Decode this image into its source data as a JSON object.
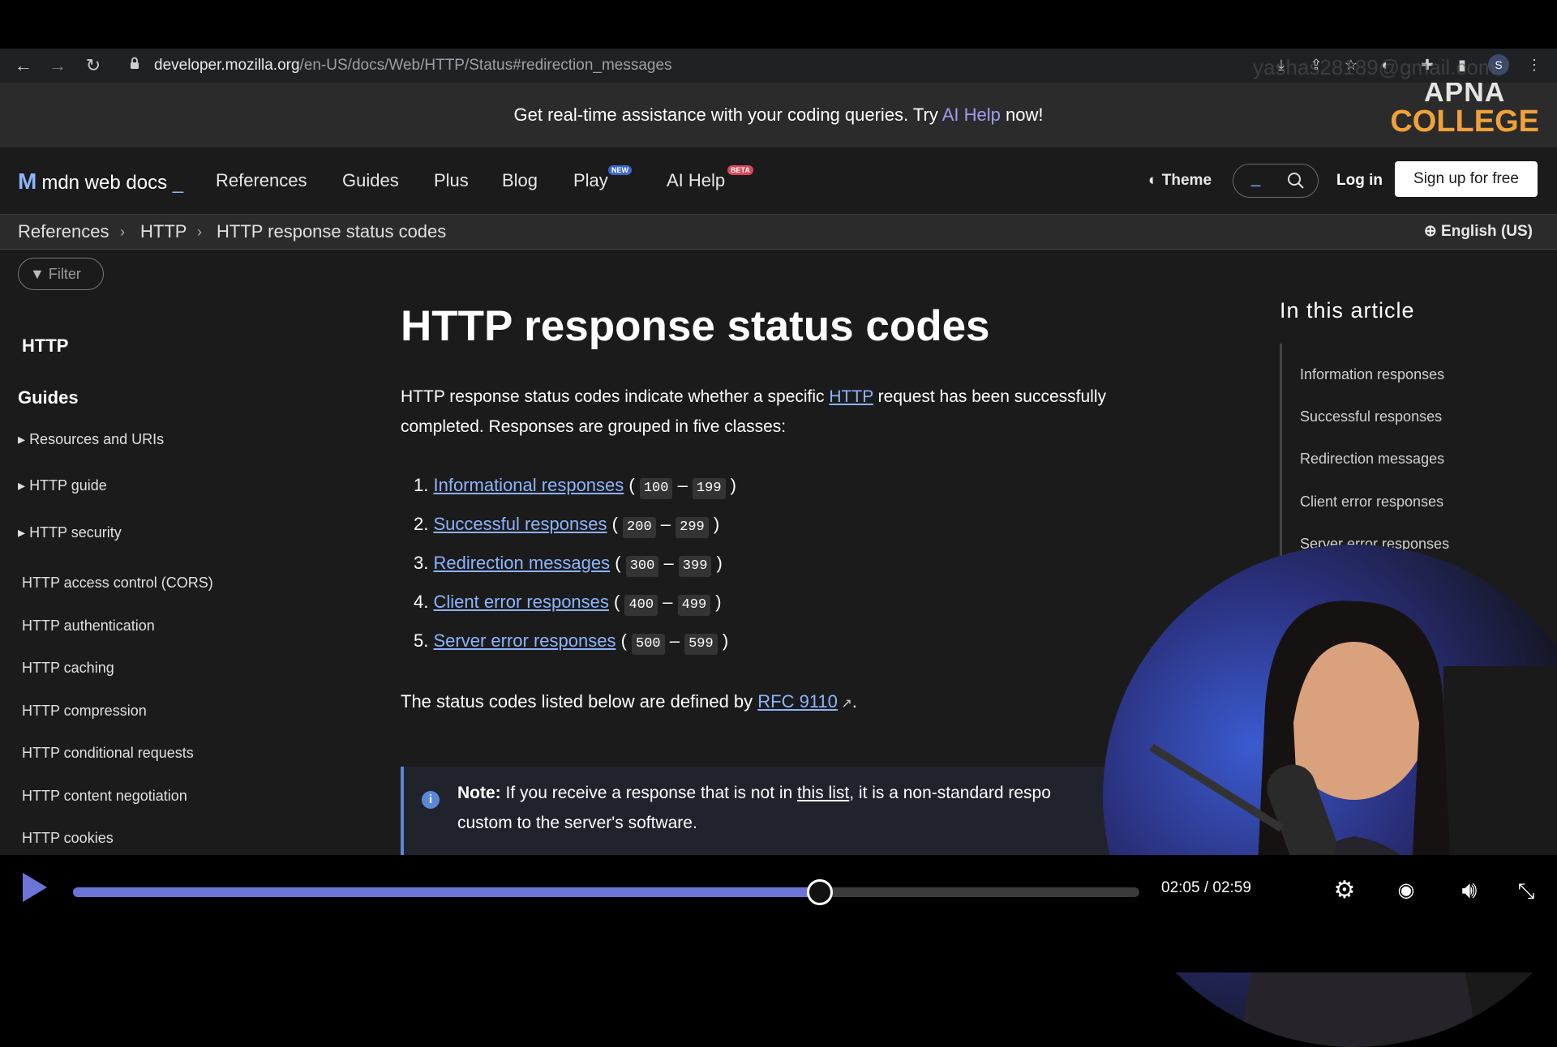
{
  "browser": {
    "url_host": "developer.mozilla.org",
    "url_path": "/en-US/docs/Web/HTTP/Status#redirection_messages",
    "avatar_letter": "S",
    "watermark_email": "yashas28189@gmail.com"
  },
  "banner": {
    "text_before": "Get real-time assistance with your coding queries. Try ",
    "link": "AI Help",
    "text_after": " now!"
  },
  "brand_watermark": {
    "line1": "APNA",
    "line2": "COLLEGE"
  },
  "header": {
    "logo_text": "mdn web docs",
    "nav": [
      "References",
      "Guides",
      "Plus",
      "Blog",
      "Play",
      "AI Help"
    ],
    "play_badge": "NEW",
    "aihelp_badge": "BETA",
    "theme": "Theme",
    "login": "Log in",
    "signup": "Sign up for free"
  },
  "breadcrumb": [
    "References",
    "HTTP",
    "HTTP response status codes"
  ],
  "language": "English (US)",
  "sidebar": {
    "filter_placeholder": "Filter",
    "section": "HTTP",
    "guides_heading": "Guides",
    "collapsible": [
      "Resources and URIs",
      "HTTP guide",
      "HTTP security"
    ],
    "items": [
      "HTTP access control (CORS)",
      "HTTP authentication",
      "HTTP caching",
      "HTTP compression",
      "HTTP conditional requests",
      "HTTP content negotiation",
      "HTTP cookies"
    ]
  },
  "article": {
    "title": "HTTP response status codes",
    "intro_before": "HTTP response status codes indicate whether a specific ",
    "intro_link": "HTTP",
    "intro_after": " request has been successfully completed. Responses are grouped in five classes:",
    "classes": [
      {
        "num": "1.",
        "label": "Informational responses",
        "from": "100",
        "to": "199"
      },
      {
        "num": "2.",
        "label": "Successful responses",
        "from": "200",
        "to": "299"
      },
      {
        "num": "3.",
        "label": "Redirection messages",
        "from": "300",
        "to": "399"
      },
      {
        "num": "4.",
        "label": "Client error responses",
        "from": "400",
        "to": "499"
      },
      {
        "num": "5.",
        "label": "Server error responses",
        "from": "500",
        "to": "599"
      }
    ],
    "defined_before": "The status codes listed below are defined by ",
    "defined_link": "RFC 9110",
    "defined_after": ".",
    "note_label": "Note:",
    "note_before": " If you receive a response that is not in ",
    "note_link": "this list",
    "note_after": ", it is a non-standard respo",
    "note_line2": "custom to the server's software."
  },
  "toc": {
    "title": "In this article",
    "items": [
      "Information responses",
      "Successful responses",
      "Redirection messages",
      "Client error responses",
      "Server error responses"
    ]
  },
  "player": {
    "time": "02:05 / 02:59",
    "progress": 0.698,
    "accent": "#6c74d8"
  },
  "colors": {
    "link": "#8cb4ff",
    "page_bg": "#1b1b1b",
    "banner_bg": "#2b2b2b"
  }
}
